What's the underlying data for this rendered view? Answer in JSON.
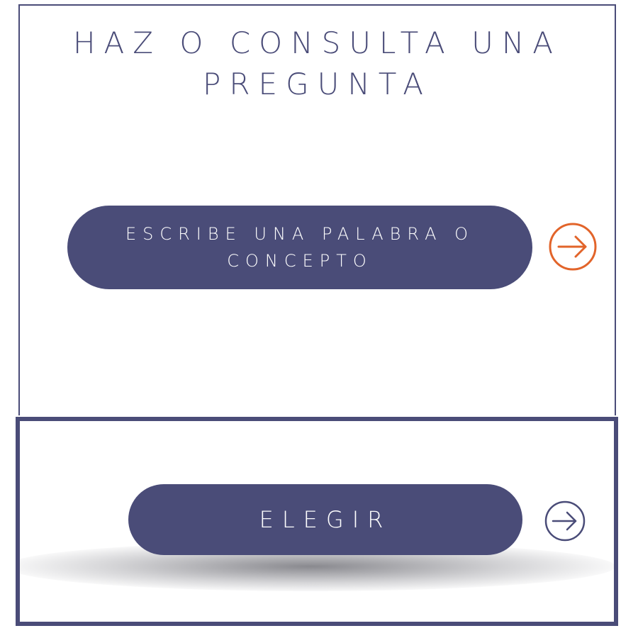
{
  "title": {
    "line1": "HAZ O CONSULTA UNA",
    "line2": "PREGUNTA"
  },
  "search_button": {
    "line1": "ESCRIBE UNA PALABRA O",
    "line2": "CONCEPTO",
    "arrow_icon": "arrow-right-circle-icon",
    "arrow_color": "#e2642a"
  },
  "choose_button": {
    "label": "ELEGIR",
    "arrow_icon": "arrow-right-circle-icon",
    "arrow_color": "#4a4c78"
  },
  "colors": {
    "primary": "#4a4c78",
    "accent": "#e2642a",
    "background": "#ffffff"
  }
}
